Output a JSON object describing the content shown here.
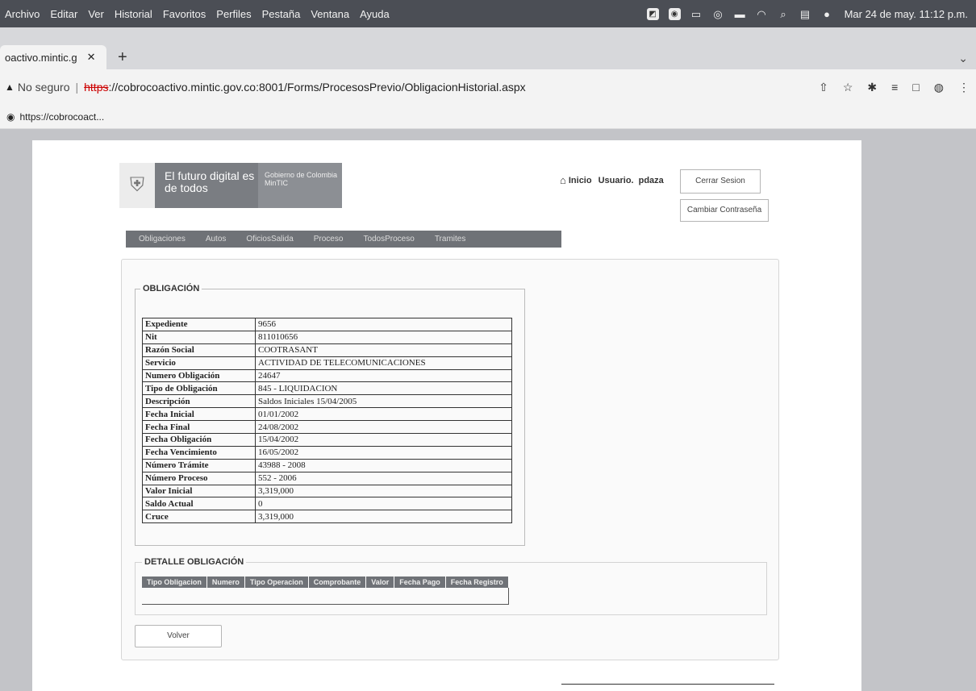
{
  "menubar": {
    "items": [
      "Archivo",
      "Editar",
      "Ver",
      "Historial",
      "Favoritos",
      "Perfiles",
      "Pestaña",
      "Ventana",
      "Ayuda"
    ],
    "clock": "Mar 24 de may. 11:12 p.m."
  },
  "browser": {
    "tab_title": "oactivo.mintic.g",
    "address": {
      "not_secure": "No seguro",
      "url_scheme": "https",
      "url_rest": "://cobrocoactivo.mintic.gov.co:8001/Forms/ProcesosPrevio/ObligacionHistorial.aspx"
    },
    "bookmark": "https://cobrocoact..."
  },
  "header": {
    "slogan": "El futuro digital es de todos",
    "gov_logo": "Gobierno de Colombia MinTIC",
    "home_label": "Inicio",
    "user_label": "Usuario.",
    "username": "pdaza",
    "logout_label": "Cerrar Sesion",
    "change_password_label": "Cambiar Contraseña"
  },
  "nav": {
    "items": [
      "Obligaciones",
      "Autos",
      "OficiosSalida",
      "Proceso",
      "TodosProceso",
      "Tramites"
    ]
  },
  "obligacion": {
    "legend": "OBLIGACIÓN",
    "rows": [
      {
        "key": "Expediente",
        "value": "9656"
      },
      {
        "key": "Nit",
        "value": "811010656"
      },
      {
        "key": "Razón Social",
        "value": "COOTRASANT"
      },
      {
        "key": "Servicio",
        "value": "ACTIVIDAD DE TELECOMUNICACIONES"
      },
      {
        "key": "Numero Obligación",
        "value": "24647"
      },
      {
        "key": "Tipo de Obligación",
        "value": "845 - LIQUIDACION"
      },
      {
        "key": "Descripción",
        "value": "Saldos Iniciales 15/04/2005"
      },
      {
        "key": "Fecha Inicial",
        "value": "01/01/2002"
      },
      {
        "key": "Fecha Final",
        "value": "24/08/2002"
      },
      {
        "key": "Fecha Obligación",
        "value": "15/04/2002"
      },
      {
        "key": "Fecha Vencimiento",
        "value": "16/05/2002"
      },
      {
        "key": "Número Trámite",
        "value": "43988 - 2008"
      },
      {
        "key": "Número Proceso",
        "value": "552 - 2006"
      },
      {
        "key": "Valor Inicial",
        "value": "3,319,000"
      },
      {
        "key": "Saldo Actual",
        "value": "0"
      },
      {
        "key": "Cruce",
        "value": "3,319,000"
      }
    ]
  },
  "detalle": {
    "legend": "DETALLE OBLIGACIÓN",
    "columns": [
      "Tipo Obligacion",
      "Numero",
      "Tipo Operacion",
      "Comprobante",
      "Valor",
      "Fecha Pago",
      "Fecha Registro"
    ]
  },
  "actions": {
    "volver_label": "Volver"
  }
}
